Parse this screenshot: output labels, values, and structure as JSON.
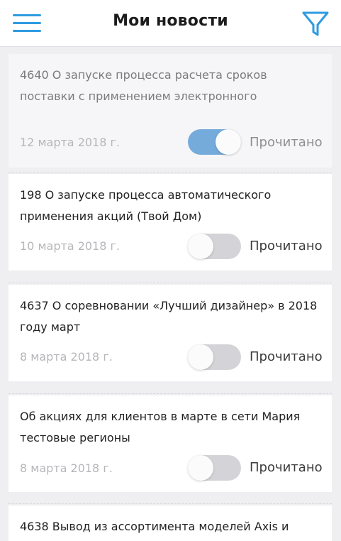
{
  "header": {
    "title": "Мои новости",
    "menu_icon": "hamburger-menu-icon",
    "filter_icon": "filter-funnel-icon",
    "accent_color": "#2f9be0"
  },
  "news": [
    {
      "title": "4640 О запуске процесса расчета сроков поставки с применением электронного",
      "date": "12 марта 2018 г.",
      "read_label": "Прочитано",
      "read": true
    },
    {
      "title": "198 О запуске процесса автоматического применения акций (Твой Дом)",
      "date": "10 марта 2018 г.",
      "read_label": "Прочитано",
      "read": false
    },
    {
      "title": "4637 О соревновании «Лучший дизайнер» в 2018 году март",
      "date": "8 марта 2018 г.",
      "read_label": "Прочитано",
      "read": false
    },
    {
      "title": "Об акциях для клиентов в марте в сети Мария тестовые регионы",
      "date": "8 марта 2018 г.",
      "read_label": "Прочитано",
      "read": false
    },
    {
      "title": "4638 Вывод из ассортимента моделей Axis и",
      "date": "",
      "read_label": "",
      "read": false
    }
  ],
  "colors": {
    "toggle_on": "#75abdb",
    "toggle_off": "#d4d4d8"
  }
}
